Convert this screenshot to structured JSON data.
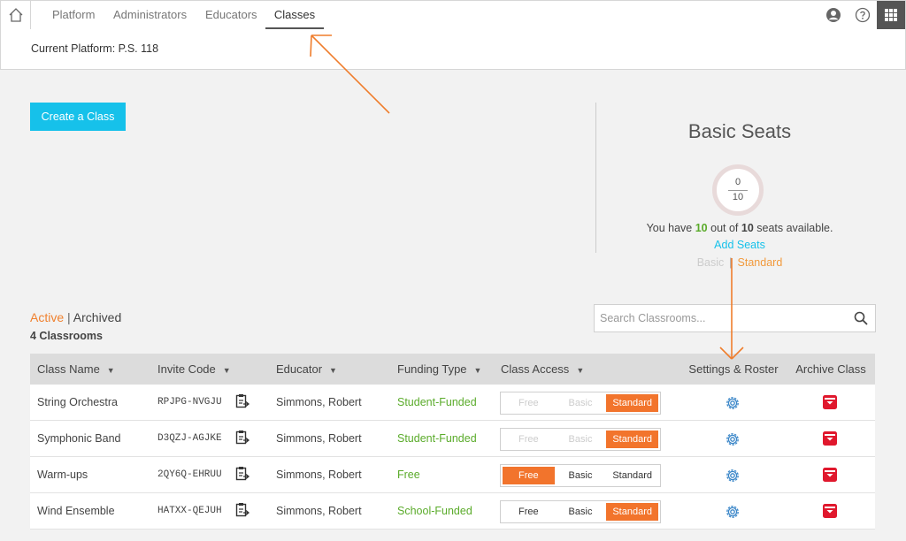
{
  "nav": {
    "tabs": [
      {
        "label": "Platform"
      },
      {
        "label": "Administrators"
      },
      {
        "label": "Educators"
      },
      {
        "label": "Classes"
      }
    ]
  },
  "platform_bar": {
    "text": "Current Platform: P.S. 118"
  },
  "create_button": "Create a Class",
  "seats": {
    "title": "Basic Seats",
    "used": "0",
    "total": "10",
    "text_prefix": "You have ",
    "available": "10",
    "text_mid": " out of ",
    "capacity": "10",
    "text_suffix": " seats available.",
    "add_seats": "Add Seats",
    "plan_basic": "Basic",
    "plan_sep": "|",
    "plan_standard": "Standard"
  },
  "filter": {
    "active": "Active",
    "sep": " | ",
    "archived": "Archived",
    "count": "4 Classrooms"
  },
  "search": {
    "placeholder": "Search Classrooms..."
  },
  "table": {
    "headers": {
      "name": "Class Name",
      "invite": "Invite Code",
      "educator": "Educator",
      "funding": "Funding Type",
      "access": "Class Access",
      "settings": "Settings & Roster",
      "archive": "Archive Class"
    },
    "rows": [
      {
        "name": "String Orchestra",
        "code": "RPJPG-NVGJU",
        "educator": "Simmons, Robert",
        "funding": "Student-Funded",
        "free": "Free",
        "basic": "Basic",
        "standard": "Standard"
      },
      {
        "name": "Symphonic Band",
        "code": "D3QZJ-AGJKE",
        "educator": "Simmons, Robert",
        "funding": "Student-Funded",
        "free": "Free",
        "basic": "Basic",
        "standard": "Standard"
      },
      {
        "name": "Warm-ups",
        "code": "2QY6Q-EHRUU",
        "educator": "Simmons, Robert",
        "funding": "Free",
        "free": "Free",
        "basic": "Basic",
        "standard": "Standard"
      },
      {
        "name": "Wind Ensemble",
        "code": "HATXX-QEJUH",
        "educator": "Simmons, Robert",
        "funding": "School-Funded",
        "free": "Free",
        "basic": "Basic",
        "standard": "Standard"
      }
    ]
  },
  "colors": {
    "accent_blue": "#16c1ea",
    "orange": "#f2742c",
    "green": "#5aab2a",
    "archive_red": "#e0182d"
  },
  "icons": [
    "home-icon",
    "account-icon",
    "help-icon",
    "apps-grid-icon",
    "search-icon",
    "copy-icon",
    "gear-icon",
    "archive-icon",
    "caret-down-icon"
  ]
}
